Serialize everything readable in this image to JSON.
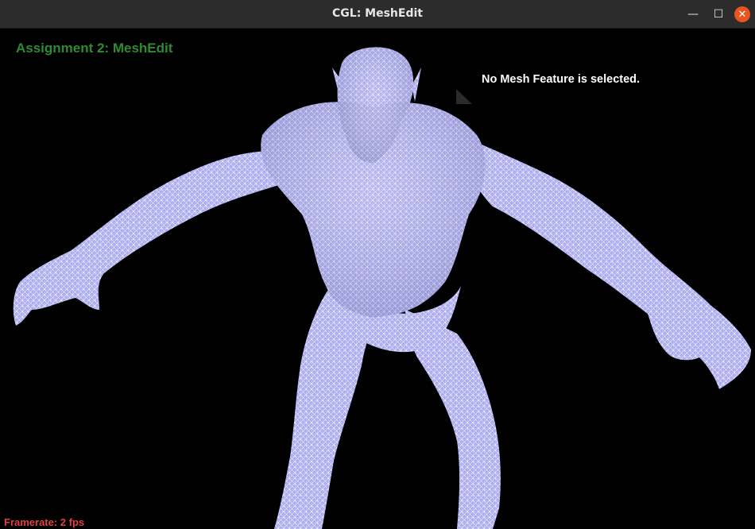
{
  "window": {
    "title": "CGL: MeshEdit",
    "buttons": {
      "minimize": "—",
      "maximize": "☐",
      "close": "✕"
    }
  },
  "hud": {
    "title": "Assignment 2: MeshEdit",
    "selection_status": "No Mesh Feature is selected.",
    "framerate": "Framerate: 2 fps"
  },
  "colors": {
    "background": "#000000",
    "title_text": "#2e8b32",
    "status_text": "#ffffff",
    "framerate_text": "#e04040",
    "mesh_fill": "#a7a7ee",
    "mesh_wire": "#ffffff",
    "close_button": "#e95420"
  }
}
